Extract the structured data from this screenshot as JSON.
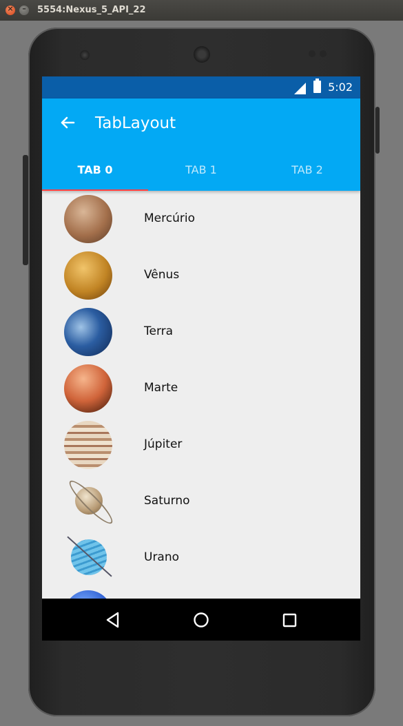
{
  "window": {
    "title": "5554:Nexus_5_API_22",
    "close_glyph": "×",
    "min_glyph": "–"
  },
  "status_bar": {
    "time": "5:02"
  },
  "app_bar": {
    "title": "TabLayout"
  },
  "tabs": [
    {
      "label": "TAB 0",
      "active": true
    },
    {
      "label": "TAB 1",
      "active": false
    },
    {
      "label": "TAB 2",
      "active": false
    }
  ],
  "planets": [
    {
      "name": "Mercúrio",
      "icon": "mercury-image"
    },
    {
      "name": "Vênus",
      "icon": "venus-image"
    },
    {
      "name": "Terra",
      "icon": "earth-image"
    },
    {
      "name": "Marte",
      "icon": "mars-image"
    },
    {
      "name": "Júpiter",
      "icon": "jupiter-image"
    },
    {
      "name": "Saturno",
      "icon": "saturn-image"
    },
    {
      "name": "Urano",
      "icon": "uranus-image"
    },
    {
      "name": "",
      "icon": "neptune-image"
    }
  ],
  "nav_bar": {
    "back": "back-triangle-icon",
    "home": "home-circle-icon",
    "recents": "recents-square-icon"
  },
  "colors": {
    "app_bar": "#03a9f4",
    "status_bar": "#0a5ea8",
    "tab_indicator": "#ff4040",
    "list_bg": "#eeeeee"
  }
}
